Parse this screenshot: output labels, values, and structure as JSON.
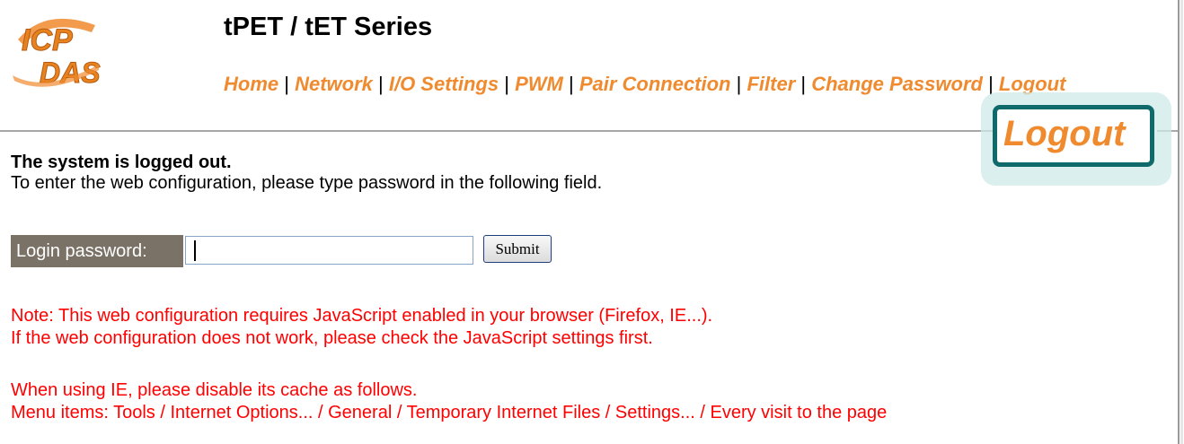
{
  "header": {
    "logo_text_top": "ICP",
    "logo_text_bottom": "DAS",
    "title": "tPET / tET Series"
  },
  "nav": {
    "items": [
      {
        "label": "Home"
      },
      {
        "label": "Network"
      },
      {
        "label": "I/O Settings"
      },
      {
        "label": "PWM"
      },
      {
        "label": "Pair Connection"
      },
      {
        "label": "Filter"
      },
      {
        "label": "Change Password"
      },
      {
        "label": "Logout"
      }
    ],
    "separator": "|"
  },
  "callout": {
    "label": "Logout"
  },
  "message": {
    "title": "The system is logged out.",
    "body": "To enter the web configuration, please type password in the following field."
  },
  "login": {
    "label": "Login password:",
    "value": "",
    "submit_label": "Submit"
  },
  "notes": {
    "line1": "Note: This web configuration requires JavaScript enabled in your browser (Firefox, IE...).",
    "line2": "If the web configuration does not work, please check the JavaScript settings first.",
    "line3": "When using IE, please disable its cache as follows.",
    "line4": "Menu items: Tools / Internet Options... / General / Temporary Internet Files / Settings... / Every visit to the page"
  },
  "colors": {
    "accent": "#f08a2e",
    "warning": "#ff0000",
    "callout_border": "#0f6b6b",
    "label_bg": "#7a7267"
  }
}
